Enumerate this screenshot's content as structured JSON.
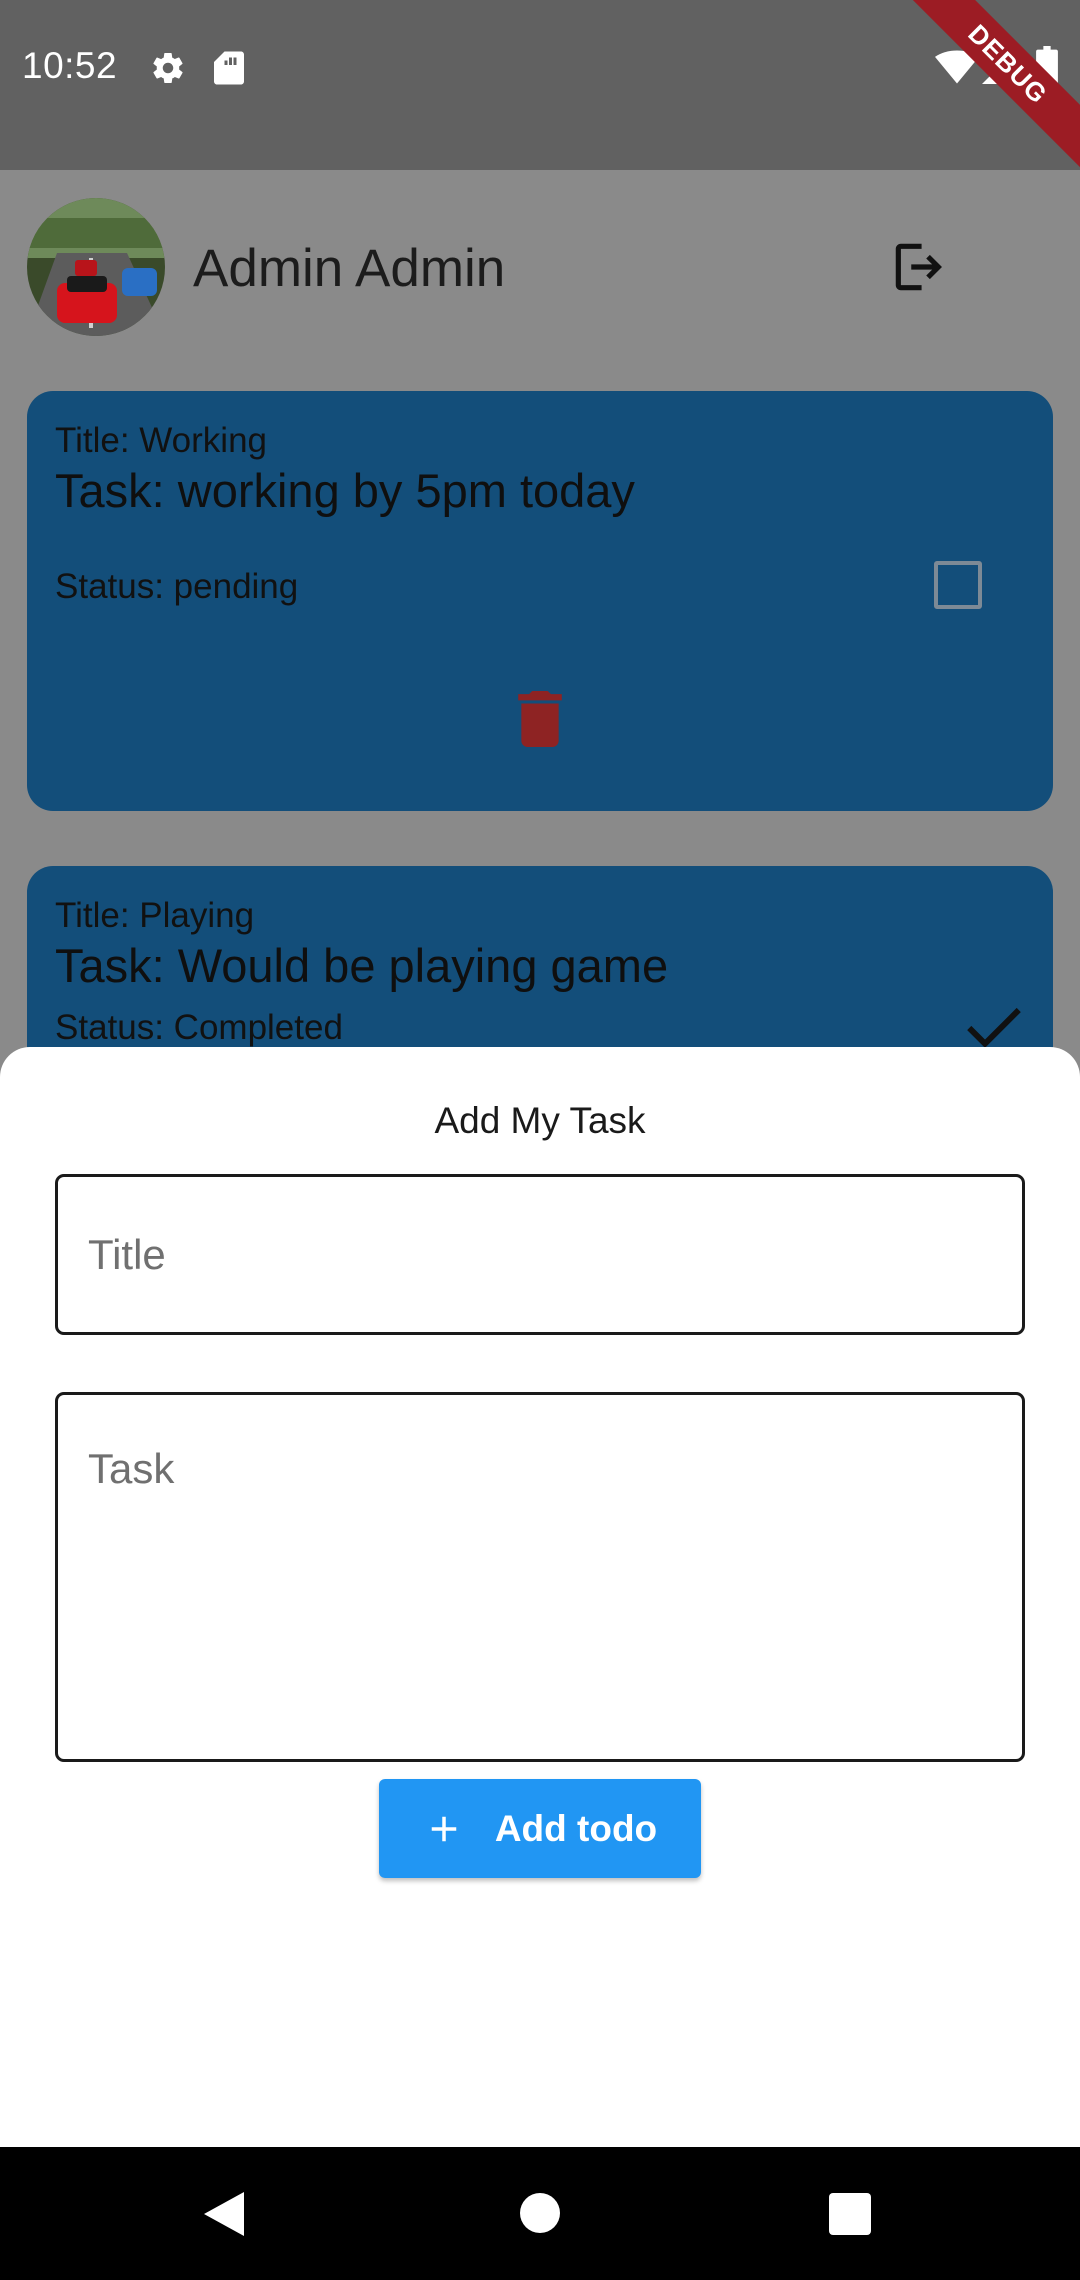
{
  "status_bar": {
    "time": "10:52",
    "icons": [
      "gear-icon",
      "sd-card-icon",
      "wifi-icon",
      "signal-icon",
      "battery-icon"
    ],
    "debug_banner": "DEBUG"
  },
  "header": {
    "user_name": "Admin Admin",
    "avatar": "car-race-avatar",
    "logout_icon": "logout-icon"
  },
  "tasks": [
    {
      "title": "Title: Working",
      "task": "Task: working by 5pm today",
      "status": "Status: pending",
      "completed": false
    },
    {
      "title": "Title: Playing",
      "task": "Task: Would be playing game",
      "status": "Status: Completed",
      "completed": true
    }
  ],
  "sheet": {
    "heading": "Add My Task",
    "title_placeholder": "Title",
    "task_placeholder": "Task",
    "add_button_label": "Add todo"
  },
  "colors": {
    "card": "#134e7a",
    "button": "#2196f3",
    "delete": "#8e2323",
    "status_bar": "#616161"
  },
  "nav_bar": {
    "icons": [
      "back-icon",
      "home-icon",
      "recents-icon"
    ]
  }
}
